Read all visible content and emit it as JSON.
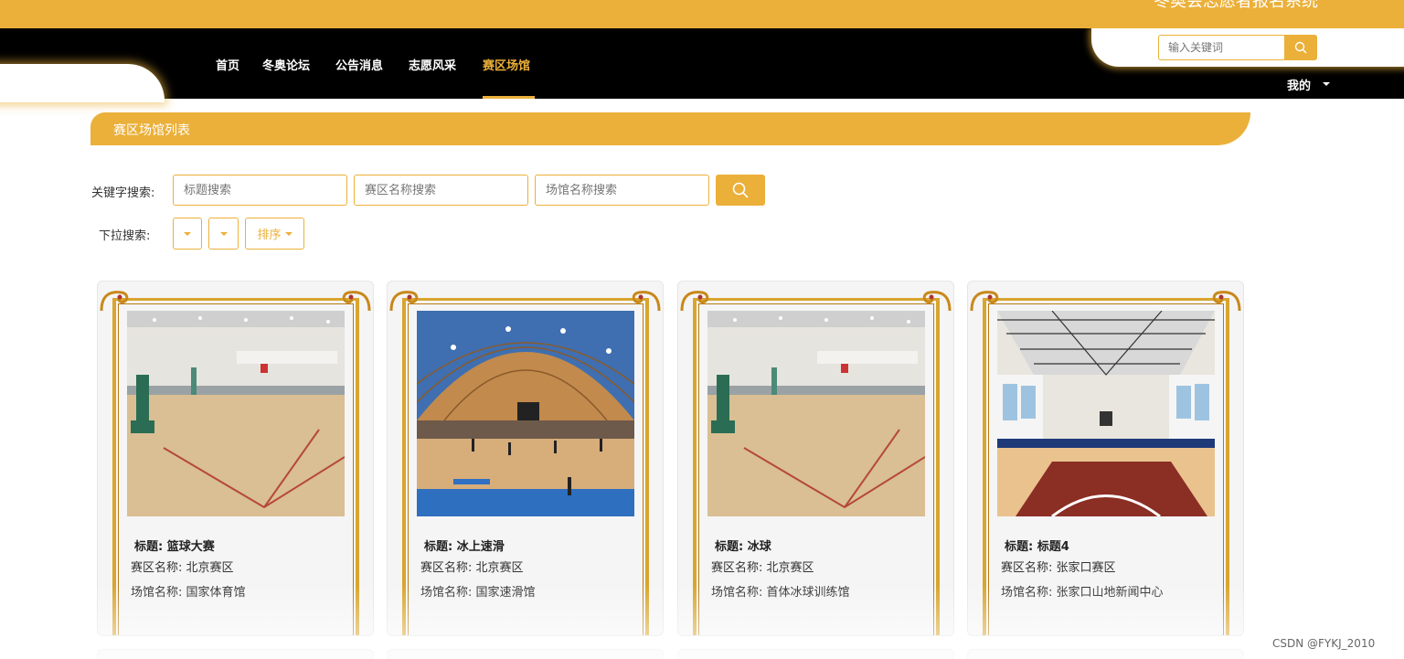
{
  "header": {
    "site_title": "冬奥会志愿者报名系统"
  },
  "nav": {
    "items": [
      "首页",
      "冬奥论坛",
      "公告消息",
      "志愿风采",
      "赛区场馆"
    ],
    "active": "赛区场馆",
    "search_placeholder": "输入关键词",
    "user_menu": "我的"
  },
  "section": {
    "title": "赛区场馆列表"
  },
  "search": {
    "keyword_label": "关键字搜索:",
    "title_placeholder": "标题搜索",
    "zone_placeholder": "赛区名称搜索",
    "venue_placeholder": "场馆名称搜索",
    "dropdown_label": "下拉搜索:",
    "sort_label": "排序"
  },
  "cards": [
    {
      "title": "标题: 篮球大赛",
      "zone": "赛区名称: 北京赛区",
      "venue": "场馆名称: 国家体育馆",
      "image": "indoor-court-gym"
    },
    {
      "title": "标题: 冰上速滑",
      "zone": "赛区名称: 北京赛区",
      "venue": "场馆名称: 国家速滑馆",
      "image": "arched-basketball-arena"
    },
    {
      "title": "标题: 冰球",
      "zone": "赛区名称: 北京赛区",
      "venue": "场馆名称: 首体冰球训练馆",
      "image": "indoor-court-gym"
    },
    {
      "title": "标题: 标题4",
      "zone": "赛区名称: 张家口赛区",
      "venue": "场馆名称: 张家口山地新闻中心",
      "image": "rendered-basketball-hall"
    }
  ],
  "colors": {
    "accent": "#ebb03a",
    "nav_bg": "#000000",
    "card_bg": "#f5f5f5"
  },
  "watermark": "CSDN @FYKJ_2010"
}
